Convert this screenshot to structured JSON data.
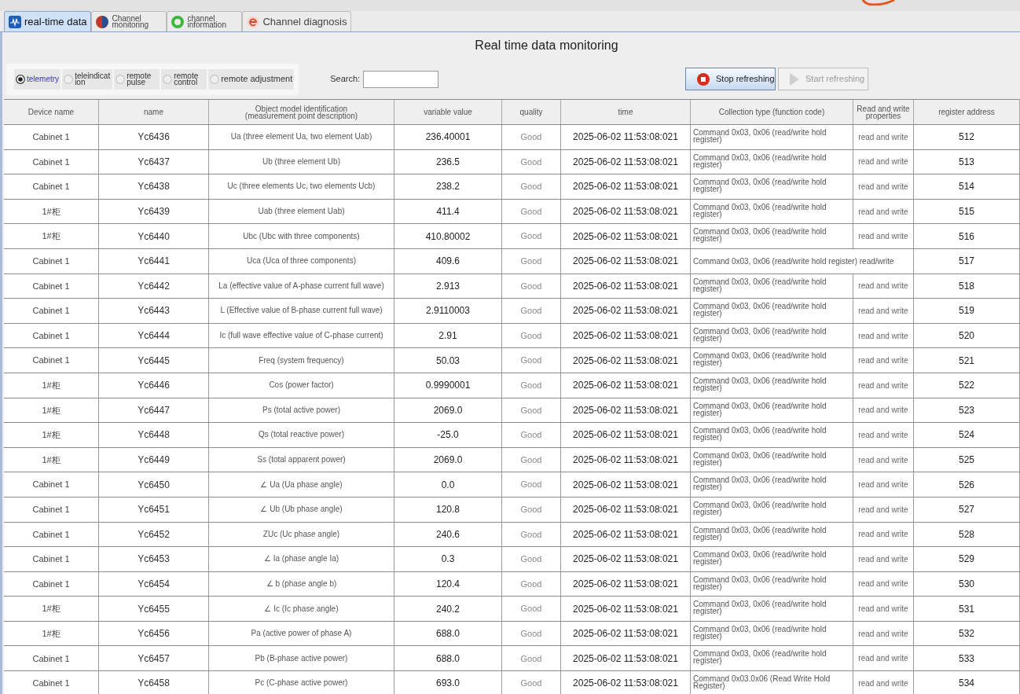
{
  "tabs": [
    {
      "label": "real-time data",
      "selected": true
    },
    {
      "label": "Channel monitoring",
      "selected": false
    },
    {
      "label": "channel information",
      "selected": false
    },
    {
      "label": "Channel diagnosis",
      "selected": false
    }
  ],
  "title": "Real time data monitoring",
  "point_types": [
    {
      "label": "telemetry",
      "selected": true
    },
    {
      "label": "teleindication",
      "selected": false
    },
    {
      "label": "remote pulse",
      "selected": false
    },
    {
      "label": "remote control",
      "selected": false
    },
    {
      "label": "remote adjustment",
      "selected": false
    }
  ],
  "search": {
    "label": "Search:"
  },
  "buttons": [
    {
      "label": "Stop refreshing",
      "disabled": false
    },
    {
      "label": "Start refreshing",
      "disabled": true
    }
  ],
  "table": {
    "columns": [
      "Device name",
      "name",
      "Object model identification (measurement point description)",
      "variable value",
      "quality",
      "time",
      "Collection type (function code)",
      "Read and write properties",
      "register address"
    ],
    "rows": [
      {
        "device": "Cabinet 1",
        "name": "Yc6436",
        "description": "Ua (three element Ua, two element Uab)",
        "value": "236.40001",
        "quality": "Good",
        "time": "2025-06-02 11:53:08:021",
        "collection": "Command 0x03, 0x06 (read/write hold register)",
        "access": "read and write",
        "register": "512"
      },
      {
        "device": "Cabinet 1",
        "name": "Yc6437",
        "description": "Ub (three element Ub)",
        "value": "236.5",
        "quality": "Good",
        "time": "2025-06-02 11:53:08:021",
        "collection": "Command 0x03, 0x06 (read/write hold register)",
        "access": "read and write",
        "register": "513"
      },
      {
        "device": "Cabinet 1",
        "name": "Yc6438",
        "description": "Uc (three elements Uc, two elements Ucb)",
        "value": "238.2",
        "quality": "Good",
        "time": "2025-06-02 11:53:08:021",
        "collection": "Command 0x03, 0x06 (read/write hold register)",
        "access": "read and write",
        "register": "514"
      },
      {
        "device": "1#柜",
        "name": "Yc6439",
        "description": "Uab (three element Uab)",
        "value": "411.4",
        "quality": "Good",
        "time": "2025-06-02 11:53:08:021",
        "collection": "Command 0x03, 0x06 (read/write hold register)",
        "access": "read and write",
        "register": "515"
      },
      {
        "device": "1#柜",
        "name": "Yc6440",
        "description": "Ubc (Ubc with three components)",
        "value": "410.80002",
        "quality": "Good",
        "time": "2025-06-02 11:53:08:021",
        "collection": "Command 0x03, 0x06 (read/write hold register)",
        "access": "read and write",
        "register": "516"
      },
      {
        "device": "Cabinet 1",
        "name": "Yc6441",
        "description": "Uca (Uca of three components)",
        "value": "409.6",
        "quality": "Good",
        "time": "2025-06-02 11:53:08:021",
        "collection": "Command 0x03, 0x06 (read/write hold register) read/write",
        "register": "517"
      },
      {
        "device": "Cabinet 1",
        "name": "Yc6442",
        "description": "La (effective value of A-phase current full wave)",
        "value": "2.913",
        "quality": "Good",
        "time": "2025-06-02 11:53:08:021",
        "collection": "Command 0x03, 0x06 (read/write hold register)",
        "access": "read and write",
        "register": "518"
      },
      {
        "device": "Cabinet 1",
        "name": "Yc6443",
        "description": "L (Effective value of B-phase current full wave)",
        "value": "2.9110003",
        "quality": "Good",
        "time": "2025-06-02 11:53:08:021",
        "collection": "Command 0x03, 0x06 (read/write hold register)",
        "access": "read and write",
        "register": "519"
      },
      {
        "device": "Cabinet 1",
        "name": "Yc6444",
        "description": "Ic (full wave effective value of C-phase current)",
        "value": "2.91",
        "quality": "Good",
        "time": "2025-06-02 11:53:08:021",
        "collection": "Command 0x03, 0x06 (read/write hold register)",
        "access": "read and write",
        "register": "520"
      },
      {
        "device": "Cabinet 1",
        "name": "Yc6445",
        "description": "Freq (system frequency)",
        "value": "50.03",
        "quality": "Good",
        "time": "2025-06-02 11:53:08:021",
        "collection": "Command 0x03, 0x06 (read/write hold register)",
        "access": "read and write",
        "register": "521"
      },
      {
        "device": "1#柜",
        "name": "Yc6446",
        "description": "Cos (power factor)",
        "value": "0.9990001",
        "quality": "Good",
        "time": "2025-06-02 11:53:08:021",
        "collection": "Command 0x03, 0x06 (read/write hold register)",
        "access": "read and write",
        "register": "522"
      },
      {
        "device": "1#柜",
        "name": "Yc6447",
        "description": "Ps (total active power)",
        "value": "2069.0",
        "quality": "Good",
        "time": "2025-06-02 11:53:08:021",
        "collection": "Command 0x03, 0x06 (read/write hold register)",
        "access": "read and write",
        "register": "523"
      },
      {
        "device": "1#柜",
        "name": "Yc6448",
        "description": "Qs (total reactive power)",
        "value": "-25.0",
        "quality": "Good",
        "time": "2025-06-02 11:53:08:021",
        "collection": "Command 0x03, 0x06 (read/write hold register)",
        "access": "read and write",
        "register": "524"
      },
      {
        "device": "1#柜",
        "name": "Yc6449",
        "description": "Ss (total apparent power)",
        "value": "2069.0",
        "quality": "Good",
        "time": "2025-06-02 11:53:08:021",
        "collection": "Command 0x03, 0x06 (read/write hold register)",
        "access": "read and write",
        "register": "525"
      },
      {
        "device": "Cabinet 1",
        "name": "Yc6450",
        "description": "∠ Ua (Ua phase angle)",
        "value": "0.0",
        "quality": "Good",
        "time": "2025-06-02 11:53:08:021",
        "collection": "Command 0x03, 0x06 (read/write hold register)",
        "access": "read and write",
        "register": "526"
      },
      {
        "device": "Cabinet 1",
        "name": "Yc6451",
        "description": "∠ Ub (Ub phase angle)",
        "value": "120.8",
        "quality": "Good",
        "time": "2025-06-02 11:53:08:021",
        "collection": "Command 0x03, 0x06 (read/write hold register)",
        "access": "read and write",
        "register": "527"
      },
      {
        "device": "Cabinet 1",
        "name": "Yc6452",
        "description": "ZUc (Uc phase angle)",
        "value": "240.6",
        "quality": "Good",
        "time": "2025-06-02 11:53:08:021",
        "collection": "Command 0x03, 0x06 (read/write hold register)",
        "access": "read and write",
        "register": "528"
      },
      {
        "device": "Cabinet 1",
        "name": "Yc6453",
        "description": "∠ Ia (phase angle Ia)",
        "value": "0.3",
        "quality": "Good",
        "time": "2025-06-02 11:53:08:021",
        "collection": "Command 0x03, 0x06 (read/write hold register)",
        "access": "read and write",
        "register": "529"
      },
      {
        "device": "Cabinet 1",
        "name": "Yc6454",
        "description": "∠ b (phase angle b)",
        "value": "120.4",
        "quality": "Good",
        "time": "2025-06-02 11:53:08:021",
        "collection": "Command 0x03, 0x06 (read/write hold register)",
        "access": "read and write",
        "register": "530"
      },
      {
        "device": "1#柜",
        "name": "Yc6455",
        "description": "∠ Ic (Ic phase angle)",
        "value": "240.2",
        "quality": "Good",
        "time": "2025-06-02 11:53:08:021",
        "collection": "Command 0x03, 0x06 (read/write hold register)",
        "access": "read and write",
        "register": "531"
      },
      {
        "device": "1#柜",
        "name": "Yc6456",
        "description": "Pa (active power of phase A)",
        "value": "688.0",
        "quality": "Good",
        "time": "2025-06-02 11:53:08:021",
        "collection": "Command 0x03, 0x06 (read/write hold register)",
        "access": "read and write",
        "register": "532"
      },
      {
        "device": "Cabinet 1",
        "name": "Yc6457",
        "description": "Pb (B-phase active power)",
        "value": "688.0",
        "quality": "Good",
        "time": "2025-06-02 11:53:08:021",
        "collection": "Command 0x03, 0x06 (read/write hold register)",
        "access": "read and write",
        "register": "533"
      },
      {
        "device": "Cabinet 1",
        "name": "Yc6458",
        "description": "Pc (C-phase active power)",
        "value": "693.0",
        "quality": "Good",
        "time": "2025-06-02 11:53:08:021",
        "collection": "Command 0x03.0x06 (Read Write Hold Register)",
        "access": "read and write",
        "register": "534"
      }
    ]
  }
}
